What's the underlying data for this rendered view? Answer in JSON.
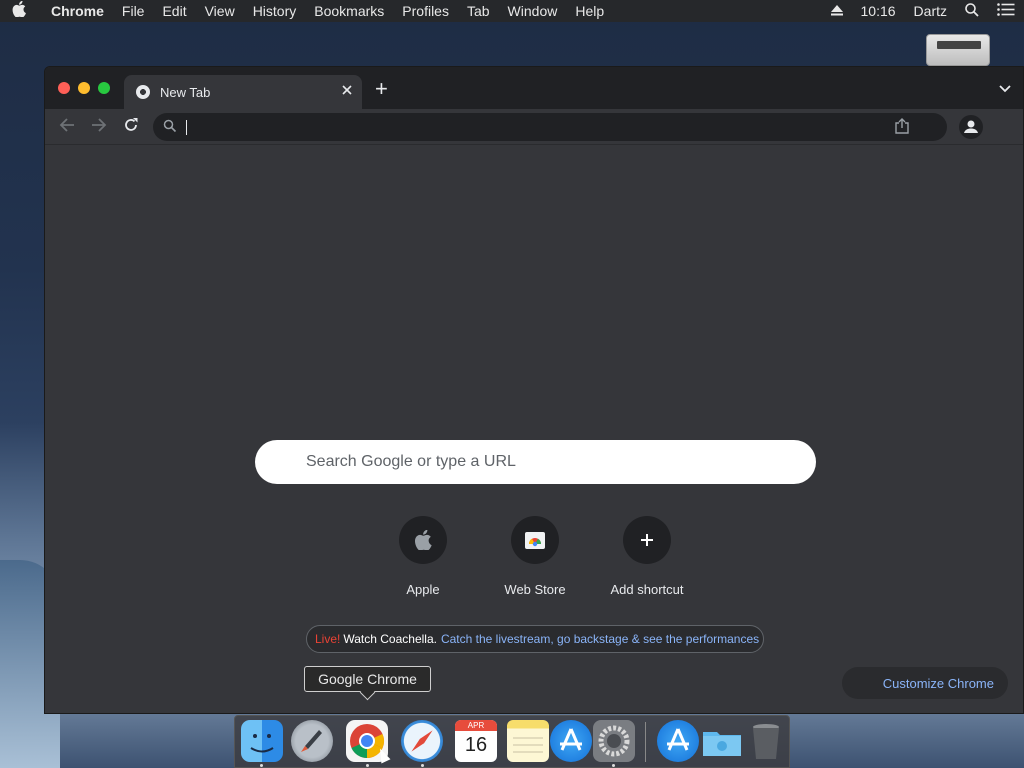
{
  "menubar": {
    "app_name": "Chrome",
    "items": [
      "File",
      "Edit",
      "View",
      "History",
      "Bookmarks",
      "Profiles",
      "Tab",
      "Window",
      "Help"
    ],
    "time": "10:16",
    "user": "Dartz",
    "apple_icon": "apple-logo-icon",
    "eject_icon": "eject-icon",
    "search_icon": "spotlight-icon",
    "list_icon": "notification-center-icon"
  },
  "window": {
    "tab": {
      "title": "New Tab",
      "favicon": "chrome-icon"
    },
    "newtab_label": "+",
    "omnibox": {
      "value": ""
    },
    "colors": {
      "window_bg": "#35363a",
      "tabstrip_bg": "#202124",
      "accent": "#8ab4f8"
    }
  },
  "ntp": {
    "search_placeholder": "Search Google or type a URL",
    "shortcuts": [
      {
        "label": "Apple",
        "icon": "apple-logo-icon"
      },
      {
        "label": "Web Store",
        "icon": "web-store-icon"
      },
      {
        "label": "Add shortcut",
        "icon": "plus-icon"
      }
    ],
    "promo": {
      "live": "Live!",
      "watch": "Watch Coachella.",
      "link": "Catch the livestream, go backstage & see the performances"
    },
    "customize_label": "Customize Chrome"
  },
  "tooltip": {
    "text": "Google Chrome"
  },
  "dock": {
    "apps": [
      {
        "name": "Finder",
        "icon": "finder-icon",
        "running": true
      },
      {
        "name": "Launchpad",
        "icon": "launchpad-icon",
        "running": false
      },
      {
        "name": "Google Chrome",
        "icon": "chrome-icon",
        "running": true
      },
      {
        "name": "Safari",
        "icon": "safari-icon",
        "running": true
      },
      {
        "name": "Calendar",
        "icon": "calendar-icon",
        "running": false,
        "month": "APR",
        "day": "16"
      },
      {
        "name": "Notes",
        "icon": "notes-icon",
        "running": false
      },
      {
        "name": "App Store",
        "icon": "app-store-icon",
        "running": false
      },
      {
        "name": "System Preferences",
        "icon": "system-preferences-icon",
        "running": true
      },
      {
        "name": "Applications",
        "icon": "applications-folder-icon",
        "running": false
      },
      {
        "name": "Downloads",
        "icon": "downloads-folder-icon",
        "running": false
      },
      {
        "name": "Trash",
        "icon": "trash-icon",
        "running": false
      }
    ]
  }
}
